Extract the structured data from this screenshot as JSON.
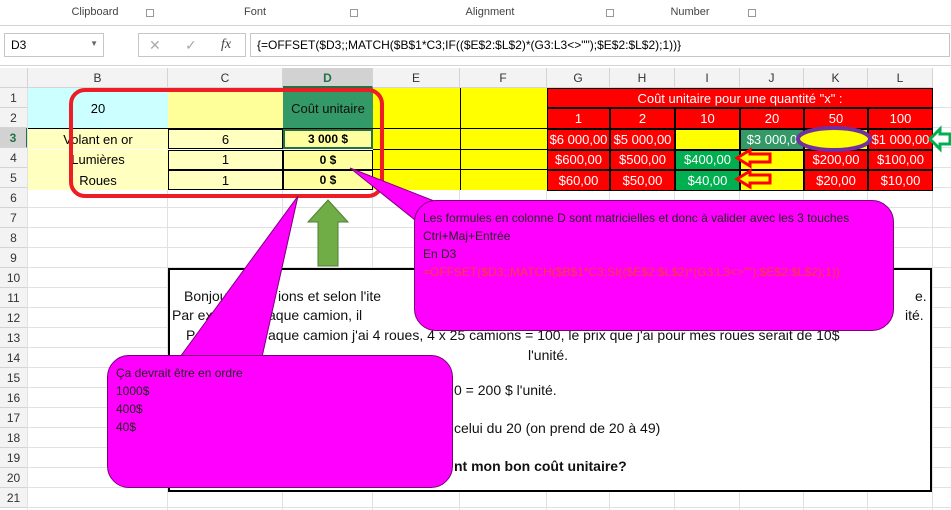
{
  "ribbon": {
    "groups": [
      "Clipboard",
      "Font",
      "Alignment",
      "Number"
    ]
  },
  "formula_bar": {
    "name_box": "D3",
    "cancel_icon": "✕",
    "enter_icon": "✓",
    "fx_label": "fx",
    "formula": "{=OFFSET($D3;;MATCH($B$1*C3;IF(($E$2:$L$2)*(G3:L3<>\"\");$E$2:$L$2);1))}"
  },
  "columns": [
    "B",
    "C",
    "D",
    "E",
    "F",
    "G",
    "H",
    "I",
    "J",
    "K",
    "L"
  ],
  "rows": [
    "1",
    "2",
    "3",
    "4",
    "5",
    "6",
    "7",
    "8",
    "9",
    "10",
    "11",
    "12",
    "13",
    "14",
    "15",
    "16",
    "17",
    "18",
    "19",
    "20",
    "21"
  ],
  "sheet": {
    "b1": "20",
    "d1": "Coût unitaire",
    "g1": "Coût unitaire pour une quantité \"x\" :",
    "quantities": [
      "1",
      "2",
      "10",
      "20",
      "50",
      "100"
    ],
    "items": [
      {
        "name": "Volant en or",
        "qty": "6",
        "cost": "3 000 $",
        "prices": [
          "$6 000,00",
          "$5 000,00",
          "",
          "$3 000,0",
          "",
          "$1 000,00"
        ]
      },
      {
        "name": "Lumières",
        "qty": "1",
        "cost": "0 $",
        "prices": [
          "$600,00",
          "$500,00",
          "$400,00",
          "",
          "$200,00",
          "$100,00"
        ]
      },
      {
        "name": "Roues",
        "qty": "1",
        "cost": "0 $",
        "prices": [
          "$60,00",
          "$50,00",
          "$40,00",
          "",
          "$20,00",
          "$10,00"
        ]
      }
    ]
  },
  "textbox": {
    "lines": [
      "Bonjour",
      "ions et selon l'ite",
      "e.",
      "Par exe",
      "aque camion, il",
      "ité.",
      "Pa",
      "aque camion j'ai 4 roues, 4 x 25 camions = 100, le prix que j'ai pour mes roues serait de 10$",
      "l'unité.",
      "0 = 200 $ l'unité.",
      "celui du 20 (on prend de 20 à 49)",
      "nt mon bon coût unitaire?"
    ]
  },
  "callout_top": {
    "lines": [
      "Les formules en colonne D sont matricielles et donc à valider avec les 3 touches",
      "Ctrl+Maj+Entrée",
      "En D3"
    ],
    "formula": "=OFFSET($D3;;MATCH($B$1*C3;SI(($E$2:$L$2)*(G3:L3<>\"\");$E$2:$L$2);1))"
  },
  "callout_bottom": {
    "lines": [
      "Ça devrait être en ordre",
      "1000$",
      "400$",
      "40$"
    ]
  },
  "colors": {
    "red": "#ff0000",
    "yellow": "#ffff00",
    "light_yellow": "#ffffa8",
    "cyan": "#ccffff",
    "green": "#339966",
    "magenta": "#ff00ff",
    "purple": "#7030a0"
  }
}
